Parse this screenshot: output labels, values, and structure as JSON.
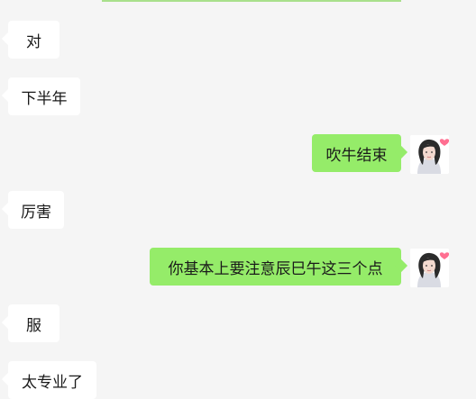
{
  "theme": {
    "background": "#f5f5f5",
    "received_bubble": "#ffffff",
    "sent_bubble": "#95ec69",
    "top_strip": "#a9e08c"
  },
  "messages": [
    {
      "side": "left",
      "text": "对"
    },
    {
      "side": "left",
      "text": "下半年"
    },
    {
      "side": "right",
      "text": "吹牛结束",
      "avatar": "user-avatar-girl"
    },
    {
      "side": "left",
      "text": "厉害"
    },
    {
      "side": "right",
      "text": "你基本上要注意辰巳午这三个点",
      "avatar": "user-avatar-girl"
    },
    {
      "side": "left",
      "text": "服"
    },
    {
      "side": "left",
      "text": "太专业了"
    }
  ]
}
